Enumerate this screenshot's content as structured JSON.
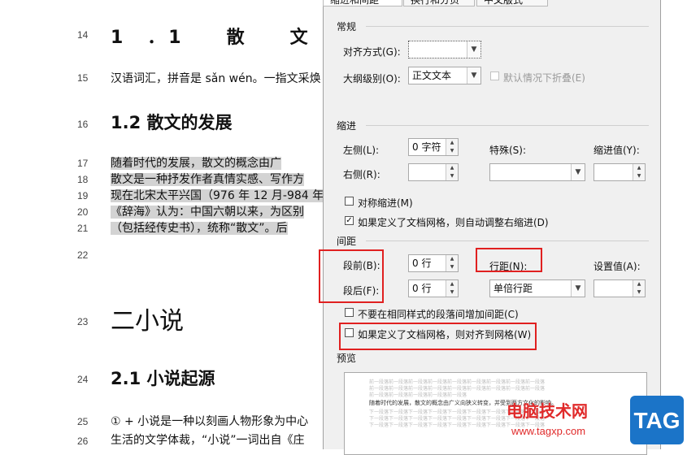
{
  "document": {
    "lines": [
      {
        "num": "14",
        "text": "1　．1　　散　　文",
        "style": "h1"
      },
      {
        "num": "15",
        "text": "汉语词汇，拼音是 sǎn wén。一指文采焕",
        "style": "body"
      },
      {
        "num": "16",
        "text": "1.2 散文的发展",
        "style": "h2"
      },
      {
        "num": "17",
        "text": "随着时代的发展，散文的概念由广",
        "style": "hl"
      },
      {
        "num": "18",
        "text": "散文是一种抒发作者真情实感、写作方",
        "style": "hl"
      },
      {
        "num": "19",
        "text": "现在北宋太平兴国（976 年 12 月-984 年",
        "style": "hl"
      },
      {
        "num": "20",
        "text": "《辞海》认为：中国六朝以来，为区别",
        "style": "hl"
      },
      {
        "num": "21",
        "text": "（包括经传史书），统称“散文”。后",
        "style": "hl"
      },
      {
        "num": "22",
        "text": "",
        "style": "body"
      },
      {
        "num": "23",
        "text": "二小说",
        "style": "big"
      },
      {
        "num": "24",
        "text": "2.1 小说起源",
        "style": "h2"
      },
      {
        "num": "25",
        "text": "① + 小说是一种以刻画人物形象为中心",
        "style": "body"
      },
      {
        "num": "26",
        "text": "生活的文学体裁，“小说”一词出自《庄",
        "style": "body"
      }
    ]
  },
  "dialog": {
    "tabs": [
      "缩进和间距",
      "换行和分页",
      "中文版式"
    ],
    "general": {
      "title": "常规",
      "align_label": "对齐方式(G):",
      "align_value": "",
      "outline_label": "大纲级别(O):",
      "outline_value": "正文文本",
      "collapse_label": "默认情况下折叠(E)"
    },
    "indent": {
      "title": "缩进",
      "left_label": "左侧(L):",
      "left_value": "0 字符",
      "right_label": "右侧(R):",
      "right_value": "",
      "special_label": "特殊(S):",
      "special_value": "",
      "indent_by_label": "缩进值(Y):",
      "indent_by_value": "",
      "mirror_label": "对称缩进(M)",
      "auto_adjust_label": "如果定义了文档网格，则自动调整右缩进(D)",
      "auto_adjust_checked": "✓"
    },
    "spacing": {
      "title": "间距",
      "before_label": "段前(B):",
      "before_value": "0 行",
      "after_label": "段后(F):",
      "after_value": "0 行",
      "line_spacing_label": "行距(N):",
      "line_spacing_value": "单倍行距",
      "at_label": "设置值(A):",
      "at_value": "",
      "no_space_label": "不要在相同样式的段落间增加间距(C)",
      "snap_grid_label": "如果定义了文档网格，则对齐到网格(W)"
    },
    "preview": {
      "title": "预览",
      "main_text": "随着时代的发展，散文的概念由广义向狭义转变，并受到西方文化的影响。"
    }
  },
  "watermark": {
    "site_name": "电脑技术网",
    "url": "www.tagxp.com",
    "logo": "TAG"
  }
}
